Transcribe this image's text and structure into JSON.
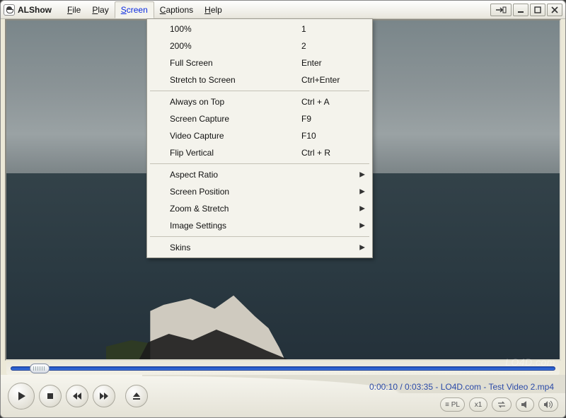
{
  "app": {
    "title": "ALShow"
  },
  "menubar": {
    "items": [
      {
        "label": "File",
        "underline": "F",
        "rest": "ile"
      },
      {
        "label": "Play",
        "underline": "P",
        "rest": "lay"
      },
      {
        "label": "Screen",
        "underline": "S",
        "rest": "creen",
        "active": true
      },
      {
        "label": "Captions",
        "underline": "C",
        "rest": "aptions"
      },
      {
        "label": "Help",
        "underline": "H",
        "rest": "elp"
      }
    ]
  },
  "screen_menu": {
    "groups": [
      [
        {
          "label": "100%",
          "shortcut": "1"
        },
        {
          "label": "200%",
          "shortcut": "2"
        },
        {
          "label": "Full Screen",
          "shortcut": "Enter"
        },
        {
          "label": "Stretch to Screen",
          "shortcut": "Ctrl+Enter"
        }
      ],
      [
        {
          "label": "Always on Top",
          "shortcut": "Ctrl + A"
        },
        {
          "label": "Screen Capture",
          "shortcut": "F9"
        },
        {
          "label": "Video Capture",
          "shortcut": "F10"
        },
        {
          "label": "Flip Vertical",
          "shortcut": "Ctrl + R"
        }
      ],
      [
        {
          "label": "Aspect Ratio",
          "submenu": true
        },
        {
          "label": "Screen Position",
          "submenu": true
        },
        {
          "label": "Zoom & Stretch",
          "submenu": true
        },
        {
          "label": "Image Settings",
          "submenu": true
        }
      ],
      [
        {
          "label": "Skins",
          "submenu": true
        }
      ]
    ]
  },
  "playback": {
    "current_time": "0:00:10",
    "total_time": "0:03:35",
    "source": "LO4D.com",
    "file": "Test Video 2.mp4",
    "info_combined": "0:00:10 / 0:03:35 - LO4D.com - Test Video 2.mp4"
  },
  "right_pills": {
    "playlist": "≡ PL",
    "speed": "x1"
  },
  "watermark": "LO4D.com"
}
